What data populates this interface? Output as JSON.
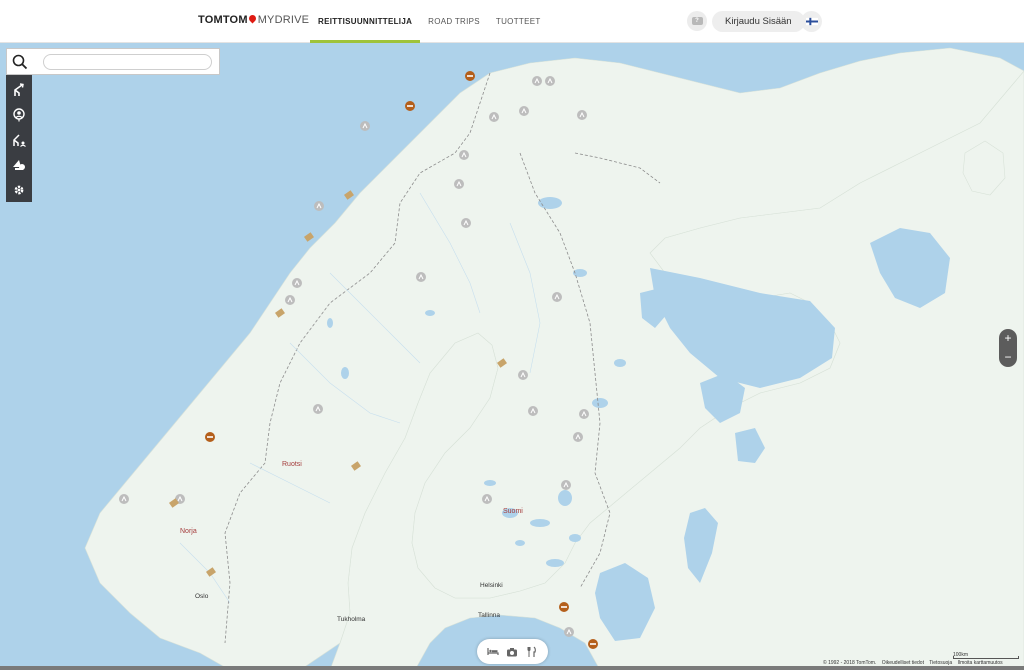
{
  "header": {
    "brand_bold": "TOMTOM",
    "brand_light": "MYDRIVE",
    "tabs": [
      {
        "label": "REITTISUUNNITTELIJA",
        "active": true
      },
      {
        "label": "ROAD TRIPS",
        "active": false
      },
      {
        "label": "TUOTTEET",
        "active": false
      }
    ],
    "help_label": "?",
    "login_label": "Kirjaudu Sisään",
    "language_flag": "finland-flag-icon"
  },
  "search": {
    "placeholder": "",
    "value": "",
    "icon": "search-icon"
  },
  "toolbar": {
    "tools": [
      "route-planner-icon",
      "places-icon",
      "my-routes-icon",
      "traffic-icon",
      "settings-icon"
    ]
  },
  "map": {
    "labels": {
      "ruotsi": "Ruotsi",
      "norja": "Norja",
      "suomi": "Suomi",
      "oslo": "Oslo",
      "helsinki": "Helsinki",
      "tallinna": "Tallinna",
      "tukholma": "Tukholma"
    },
    "colors": {
      "water": "#aed2ea",
      "land": "#eef4ee",
      "border": "#8c8c8c",
      "incident": "#b45f1b",
      "roadworks": "#c8a46a",
      "camera": "#b8b8b8"
    }
  },
  "zoom": {
    "in_label": "+",
    "out_label": "−"
  },
  "categories": [
    "hotel-icon",
    "camera-icon",
    "restaurant-icon"
  ],
  "footer": {
    "scale_label": "100km",
    "copyright": "© 1992 - 2018 TomTom.",
    "links": [
      "Oikeudelliset tiedot",
      "Tietosuoja",
      "Ilmoita karttamuutos"
    ]
  }
}
